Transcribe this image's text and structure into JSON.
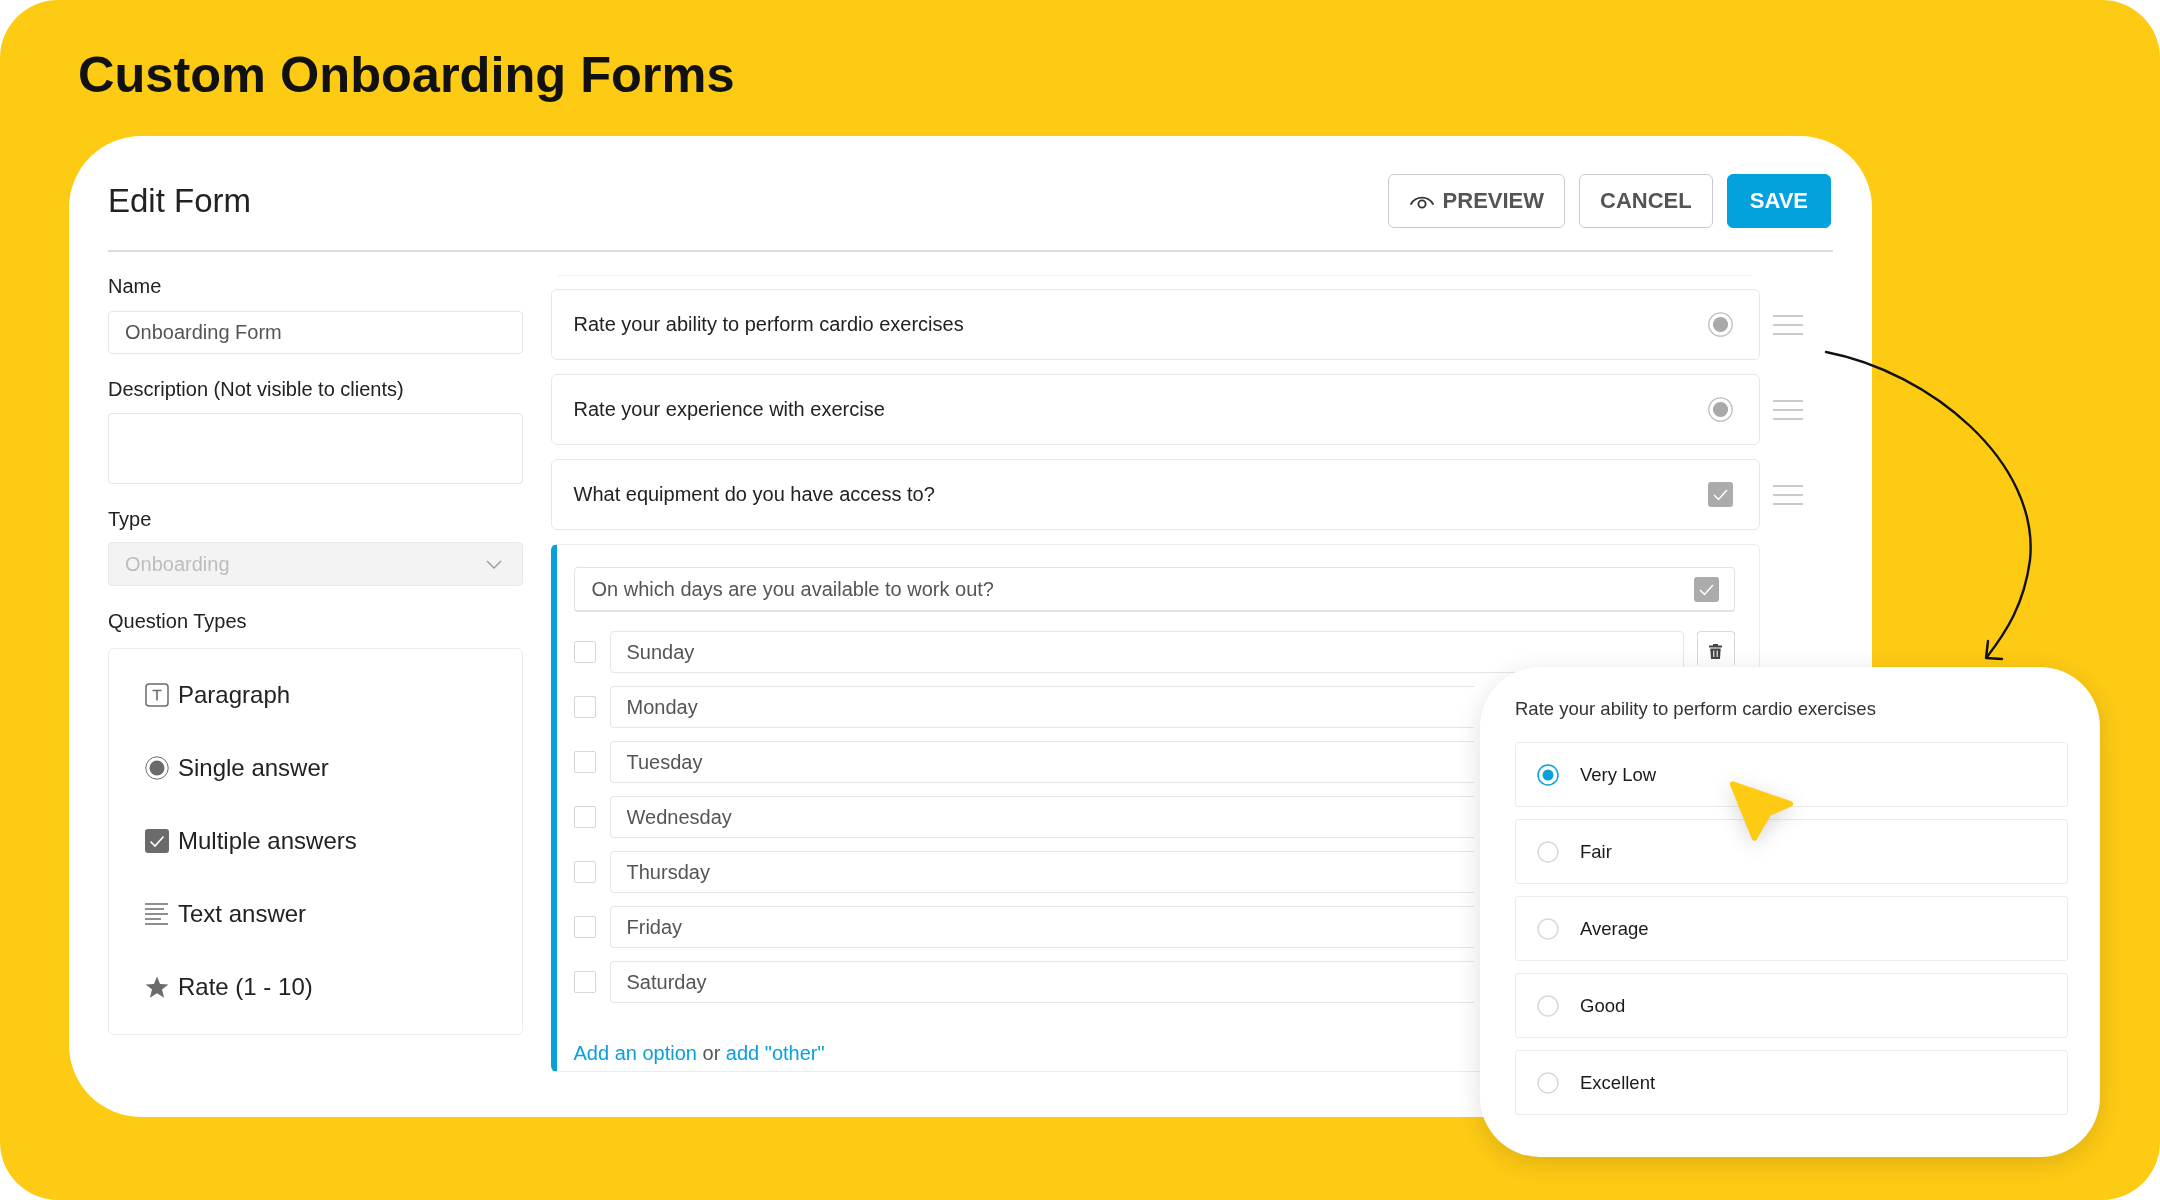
{
  "page": {
    "title": "Custom Onboarding Forms"
  },
  "editor": {
    "title": "Edit Form",
    "buttons": [
      {
        "label": "PREVIEW",
        "kind": "icon_outline"
      },
      {
        "label": "CANCEL",
        "kind": "outline"
      },
      {
        "label": "SAVE",
        "kind": "filled"
      }
    ]
  },
  "form_settings": {
    "name": {
      "label": "Name",
      "value": "Onboarding Form"
    },
    "description": {
      "label": "Description (Not visible to clients)"
    },
    "type": {
      "label": "Type",
      "value": "Onboarding",
      "disabled": true
    },
    "question_types": {
      "label": "Question Types",
      "items": [
        {
          "label": "Paragraph",
          "kind": "paragraph"
        },
        {
          "label": "Single answer",
          "kind": "single"
        },
        {
          "label": "Multiple answers",
          "kind": "multiple"
        },
        {
          "label": "Text answer",
          "kind": "text"
        },
        {
          "label": "Rate (1 - 10)",
          "kind": "rate"
        }
      ]
    }
  },
  "questions": [
    {
      "text": "Rate your ability to perform cardio exercises",
      "kind": "single",
      "expanded": false
    },
    {
      "text": "Rate your experience with exercise",
      "kind": "single",
      "expanded": false
    },
    {
      "text": "What equipment do you have access to?",
      "kind": "multiple",
      "expanded": false
    },
    {
      "text": "On which days are you available to work out?",
      "kind": "multiple",
      "expanded": true,
      "options": [
        {
          "label": "Sunday",
          "checked": false
        },
        {
          "label": "Monday",
          "checked": false
        },
        {
          "label": "Tuesday",
          "checked": false
        },
        {
          "label": "Wednesday",
          "checked": false
        },
        {
          "label": "Thursday",
          "checked": false
        },
        {
          "label": "Friday",
          "checked": false
        },
        {
          "label": "Saturday",
          "checked": false
        }
      ],
      "add_option": {
        "link": "Add an option",
        "separator": "or",
        "other_link": "add \"other\""
      }
    }
  ],
  "preview": {
    "question": "Rate your ability to perform cardio exercises",
    "options": [
      {
        "label": "Very Low",
        "selected": true
      },
      {
        "label": "Fair",
        "selected": false
      },
      {
        "label": "Average",
        "selected": false
      },
      {
        "label": "Good",
        "selected": false
      },
      {
        "label": "Excellent",
        "selected": false
      }
    ]
  }
}
